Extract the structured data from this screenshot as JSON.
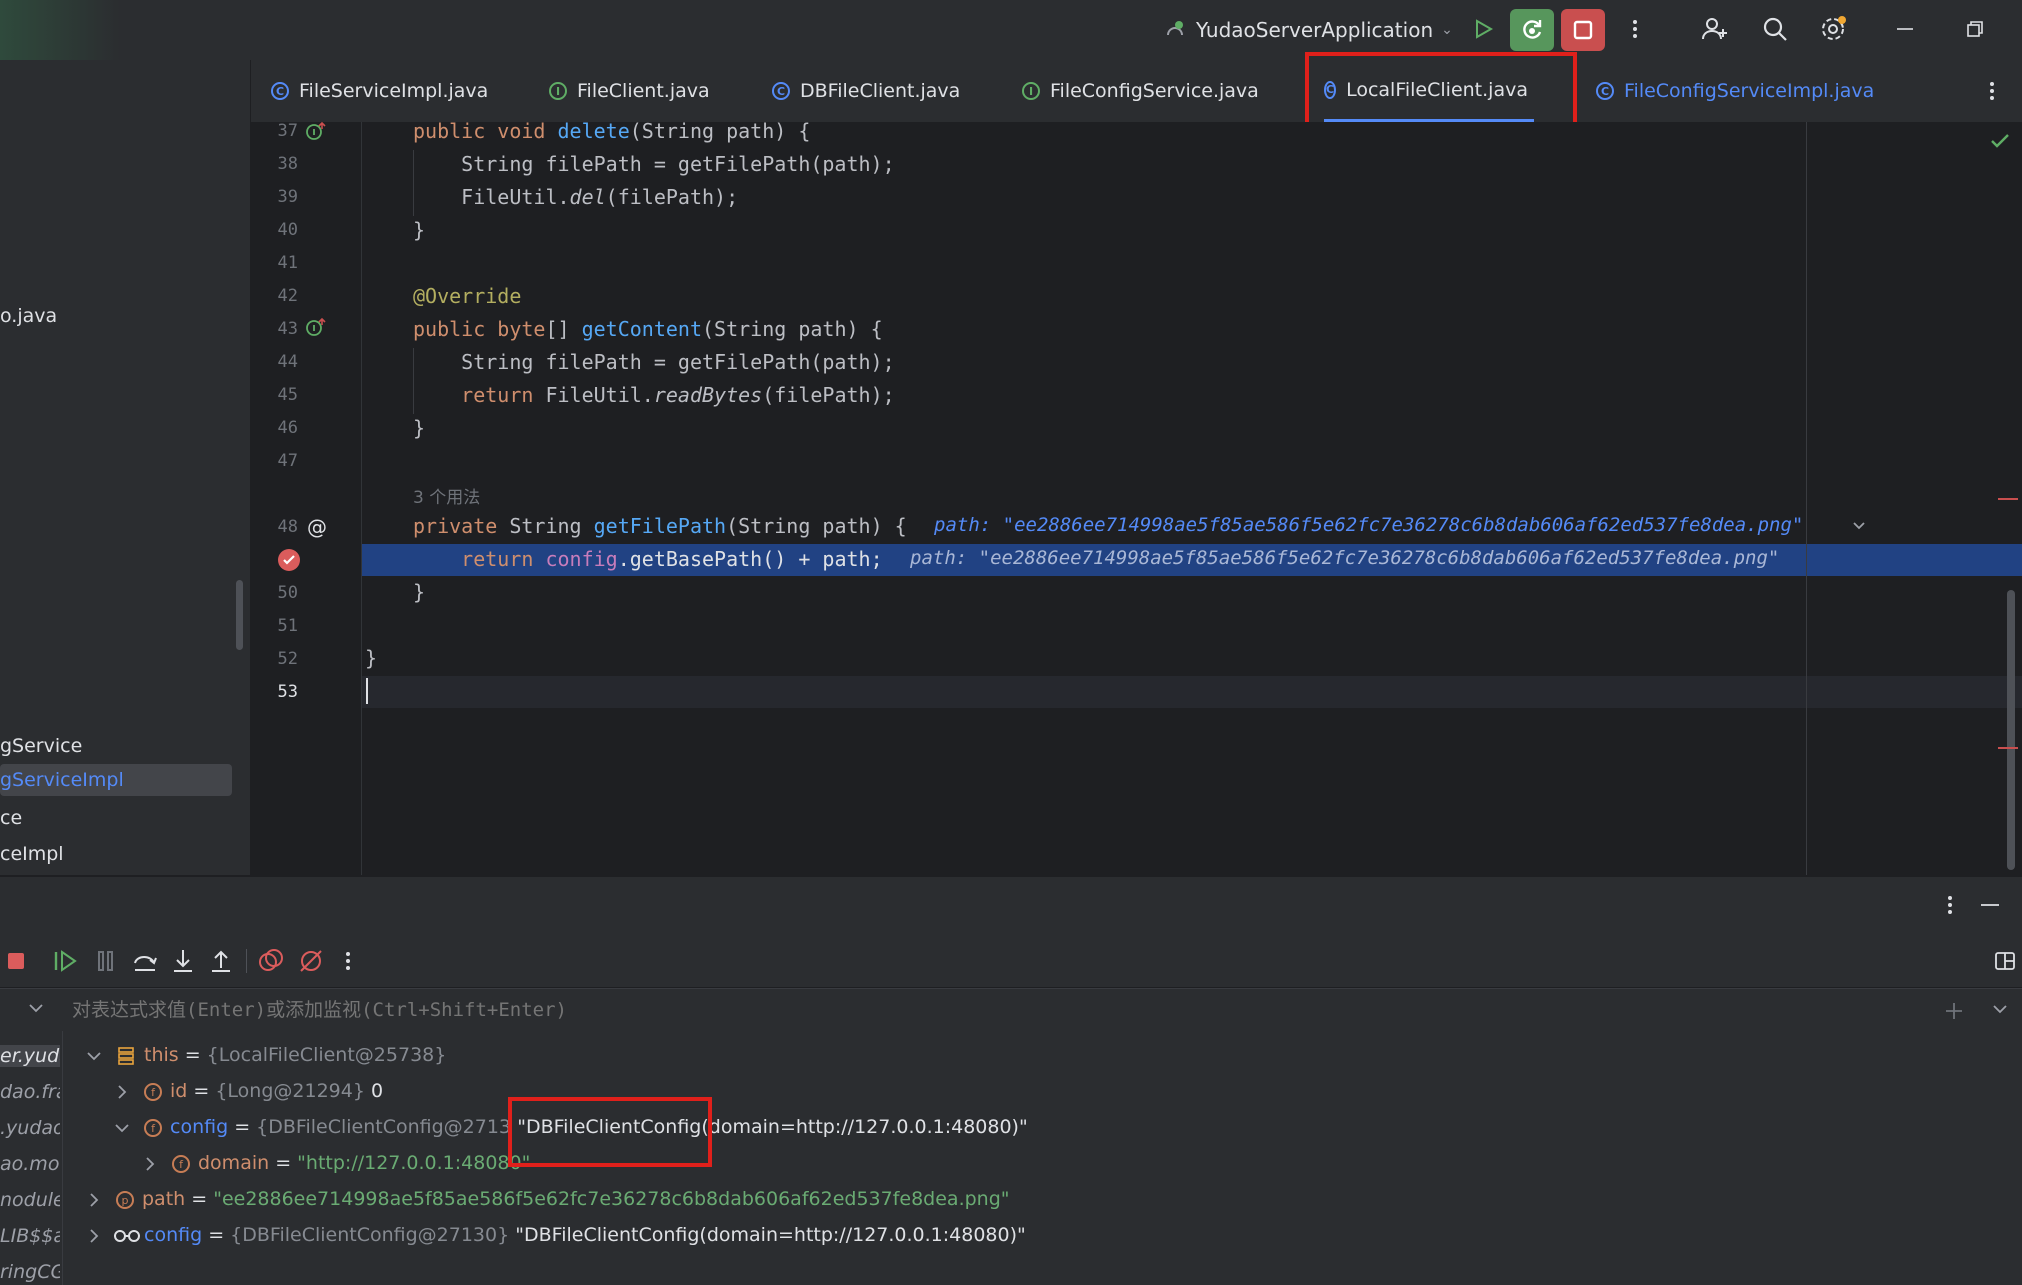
{
  "titlebar": {
    "run_config": "YudaoServerApplication"
  },
  "project_panel": {
    "items": [
      "o.java",
      "gService",
      "gServiceImpl",
      "ce",
      "ceImpl"
    ]
  },
  "tabs": [
    {
      "label": "FileServiceImpl.java",
      "kind": "class"
    },
    {
      "label": "FileClient.java",
      "kind": "interface"
    },
    {
      "label": "DBFileClient.java",
      "kind": "class"
    },
    {
      "label": "FileConfigService.java",
      "kind": "interface"
    },
    {
      "label": "LocalFileClient.java",
      "kind": "class",
      "active": true
    },
    {
      "label": "FileConfigServiceImpl.java",
      "kind": "class"
    }
  ],
  "editor": {
    "line_numbers": [
      "37",
      "38",
      "39",
      "40",
      "41",
      "42",
      "43",
      "44",
      "45",
      "46",
      "47",
      "48",
      "50",
      "51",
      "52",
      "53"
    ],
    "usages_hint": "3 个用法",
    "lines": {
      "l37": "public void delete(String path) {",
      "l38": "    String filePath = getFilePath(path);",
      "l39a": "    FileUtil.",
      "l39b": "del",
      "l39c": "(filePath);",
      "l40": "}",
      "l42": "@Override",
      "l43": "public byte[] getContent(String path) {",
      "l44": "    String filePath = getFilePath(path);",
      "l45a": "    return FileUtil.",
      "l45b": "readBytes",
      "l45c": "(filePath);",
      "l46": "}",
      "l48": "private String getFilePath(String path) {",
      "l49": "    return config.getBasePath() + path;",
      "l50": "}",
      "l52": "}"
    },
    "inline_values": {
      "l48": "path: \"ee2886ee714998ae5f85ae586f5e62fc7e36278c6b8dab606af62ed537fe8dea.png\"",
      "l49": "path: \"ee2886ee714998ae5f85ae586f5e62fc7e36278c6b8dab606af62ed537fe8dea.png\""
    }
  },
  "debugger": {
    "eval_placeholder": "对表达式求值(Enter)或添加监视(Ctrl+Shift+Enter)",
    "frames": [
      "er.yudao",
      "dao.fra",
      ".yudao.",
      "ao.mod",
      "nodule.i",
      "LIB$$a",
      "ringCG"
    ],
    "variables": [
      {
        "name": "this",
        "ref": "{LocalFileClient@25738}",
        "value": ""
      },
      {
        "name": "id",
        "ref": "{Long@21294}",
        "value": "0"
      },
      {
        "name": "config",
        "ref": "{DBFileClientConfig@27130}",
        "value": "\"DBFileClientConfig(domain=http://127.0.0.1:48080)\""
      },
      {
        "name": "domain",
        "ref": "",
        "value": "\"http://127.0.0.1:48080\""
      },
      {
        "name": "path",
        "ref": "",
        "value": "\"ee2886ee714998ae5f85ae586f5e62fc7e36278c6b8dab606af62ed537fe8dea.png\""
      },
      {
        "name": "config",
        "ref": "{DBFileClientConfig@27130}",
        "value": "\"DBFileClientConfig(domain=http://127.0.0.1:48080)\""
      }
    ]
  },
  "icons": [
    "run-icon",
    "debug-icon",
    "stop-icon",
    "more-icon",
    "add-user-icon",
    "search-icon",
    "settings-icon",
    "minimize-icon",
    "restore-icon",
    "close-tab-icon",
    "check-icon",
    "breakpoint-icon",
    "resume-icon",
    "pause-icon",
    "step-over-icon",
    "step-into-icon",
    "step-out-icon",
    "view-breakpoints-icon",
    "mute-breakpoints-icon",
    "layout-icon"
  ],
  "colors": {
    "accent": "#548af7",
    "highlight_box": "#e0201b",
    "exec_line": "#214283"
  }
}
